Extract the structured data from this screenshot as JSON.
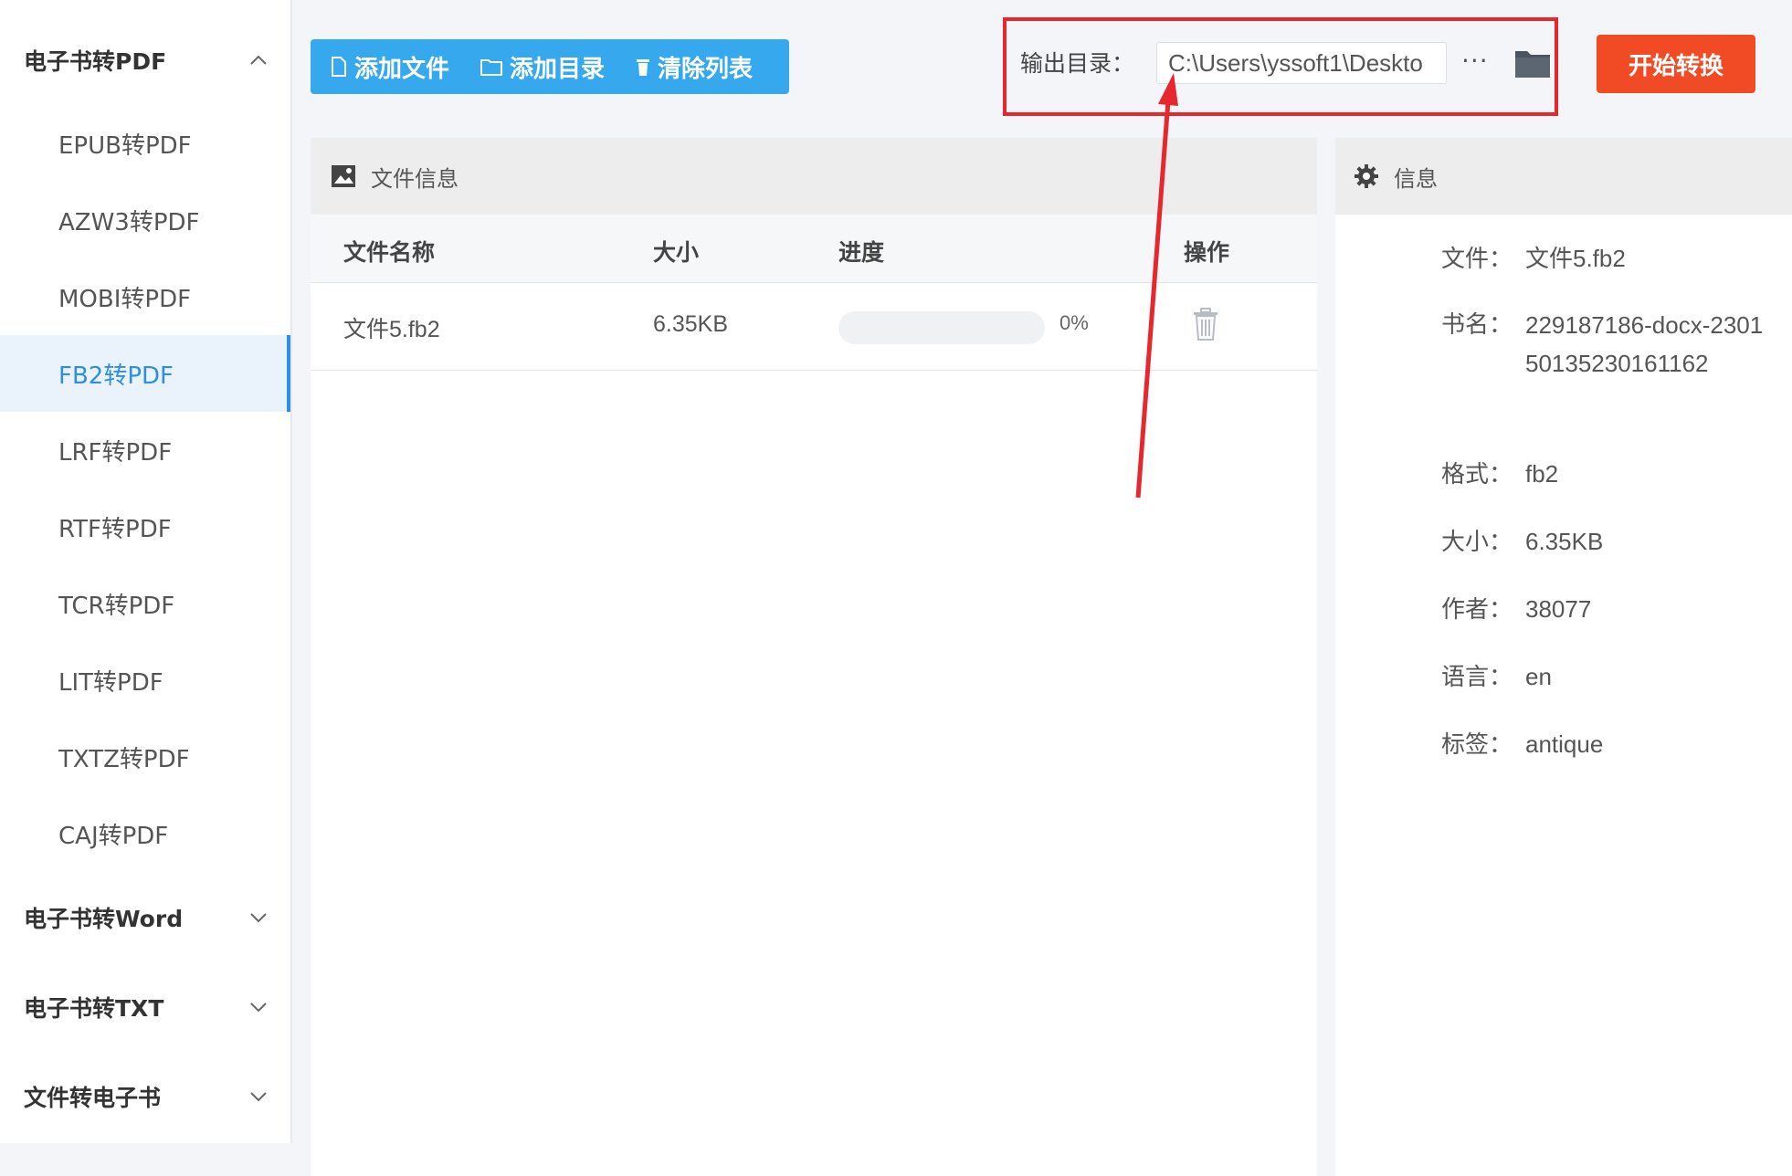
{
  "sidebar": {
    "groups": [
      {
        "label": "电子书转PDF",
        "expanded": true
      },
      {
        "label": "电子书转Word",
        "expanded": false
      },
      {
        "label": "电子书转TXT",
        "expanded": false
      },
      {
        "label": "文件转电子书",
        "expanded": false
      }
    ],
    "pdf_items": [
      "EPUB转PDF",
      "AZW3转PDF",
      "MOBI转PDF",
      "FB2转PDF",
      "LRF转PDF",
      "RTF转PDF",
      "TCR转PDF",
      "LIT转PDF",
      "TXTZ转PDF",
      "CAJ转PDF"
    ],
    "active_item": "FB2转PDF"
  },
  "toolbar": {
    "add_file": "添加文件",
    "add_dir": "添加目录",
    "clear_list": "清除列表"
  },
  "output": {
    "label": "输出目录：",
    "path": "C:\\Users\\yssoft1\\Deskto",
    "more": "···",
    "start": "开始转换"
  },
  "files_panel": {
    "title": "文件信息",
    "columns": {
      "name": "文件名称",
      "size": "大小",
      "progress": "进度",
      "action": "操作"
    },
    "rows": [
      {
        "name": "文件5.fb2",
        "size": "6.35KB",
        "progress_pct": 0,
        "progress_label": "0%"
      }
    ]
  },
  "info_panel": {
    "title": "信息",
    "fields": [
      {
        "key": "文件：",
        "value": "文件5.fb2"
      },
      {
        "key": "书名：",
        "value": "229187186-docx-230150135230161162"
      },
      {
        "key": "格式：",
        "value": "fb2"
      },
      {
        "key": "大小：",
        "value": "6.35KB"
      },
      {
        "key": "作者：",
        "value": "38077"
      },
      {
        "key": "语言：",
        "value": "en"
      },
      {
        "key": "标签：",
        "value": "antique"
      }
    ]
  },
  "colors": {
    "accent_blue": "#35a8ee",
    "start_red": "#f04b25",
    "highlight_red": "#e6272d"
  }
}
